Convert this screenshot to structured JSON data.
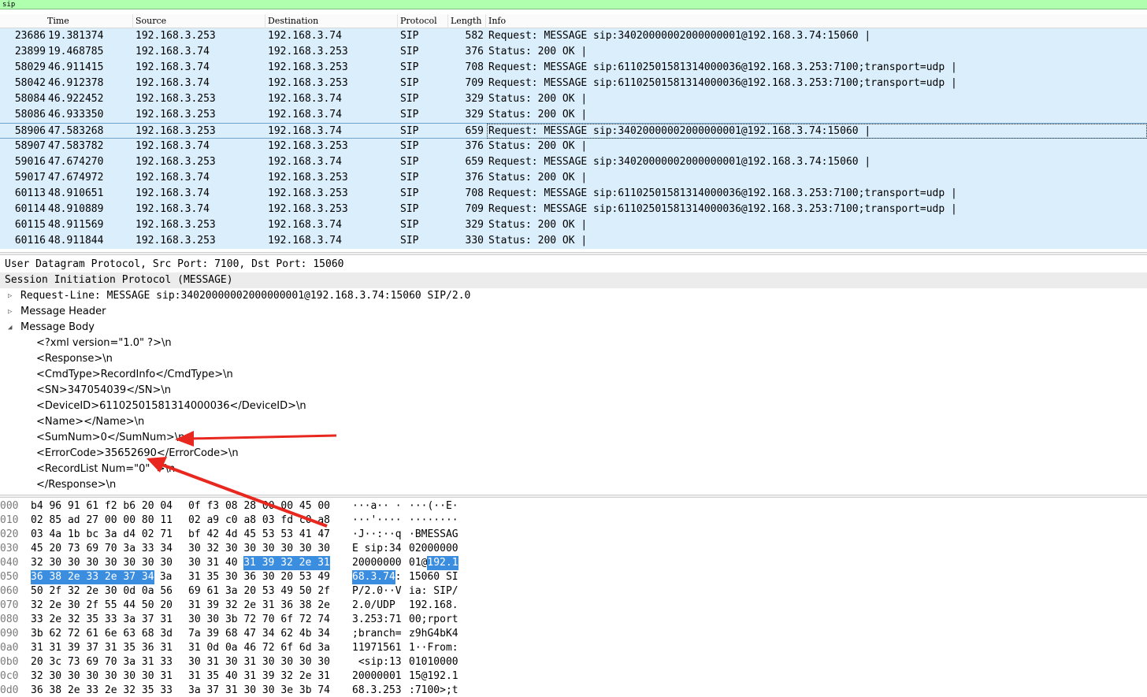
{
  "filter": {
    "value": "sip"
  },
  "columns": [
    "Time",
    "Source",
    "Destination",
    "Protocol",
    "Length",
    "Info"
  ],
  "packets": [
    {
      "no": "23686",
      "time": "19.381374",
      "src": "192.168.3.253",
      "dst": "192.168.3.74",
      "proto": "SIP",
      "len": "582",
      "info": "Request: MESSAGE sip:34020000002000000001@192.168.3.74:15060 |"
    },
    {
      "no": "23899",
      "time": "19.468785",
      "src": "192.168.3.74",
      "dst": "192.168.3.253",
      "proto": "SIP",
      "len": "376",
      "info": "Status: 200 OK |"
    },
    {
      "no": "58029",
      "time": "46.911415",
      "src": "192.168.3.74",
      "dst": "192.168.3.253",
      "proto": "SIP",
      "len": "708",
      "info": "Request: MESSAGE sip:61102501581314000036@192.168.3.253:7100;transport=udp |"
    },
    {
      "no": "58042",
      "time": "46.912378",
      "src": "192.168.3.74",
      "dst": "192.168.3.253",
      "proto": "SIP",
      "len": "709",
      "info": "Request: MESSAGE sip:61102501581314000036@192.168.3.253:7100;transport=udp |"
    },
    {
      "no": "58084",
      "time": "46.922452",
      "src": "192.168.3.253",
      "dst": "192.168.3.74",
      "proto": "SIP",
      "len": "329",
      "info": "Status: 200 OK |"
    },
    {
      "no": "58086",
      "time": "46.933350",
      "src": "192.168.3.253",
      "dst": "192.168.3.74",
      "proto": "SIP",
      "len": "329",
      "info": "Status: 200 OK |"
    },
    {
      "no": "58906",
      "time": "47.583268",
      "src": "192.168.3.253",
      "dst": "192.168.3.74",
      "proto": "SIP",
      "len": "659",
      "info": "Request: MESSAGE sip:34020000002000000001@192.168.3.74:15060 |"
    },
    {
      "no": "58907",
      "time": "47.583782",
      "src": "192.168.3.74",
      "dst": "192.168.3.253",
      "proto": "SIP",
      "len": "376",
      "info": "Status: 200 OK |"
    },
    {
      "no": "59016",
      "time": "47.674270",
      "src": "192.168.3.253",
      "dst": "192.168.3.74",
      "proto": "SIP",
      "len": "659",
      "info": "Request: MESSAGE sip:34020000002000000001@192.168.3.74:15060 |"
    },
    {
      "no": "59017",
      "time": "47.674972",
      "src": "192.168.3.74",
      "dst": "192.168.3.253",
      "proto": "SIP",
      "len": "376",
      "info": "Status: 200 OK |"
    },
    {
      "no": "60113",
      "time": "48.910651",
      "src": "192.168.3.74",
      "dst": "192.168.3.253",
      "proto": "SIP",
      "len": "708",
      "info": "Request: MESSAGE sip:61102501581314000036@192.168.3.253:7100;transport=udp |"
    },
    {
      "no": "60114",
      "time": "48.910889",
      "src": "192.168.3.74",
      "dst": "192.168.3.253",
      "proto": "SIP",
      "len": "709",
      "info": "Request: MESSAGE sip:61102501581314000036@192.168.3.253:7100;transport=udp |"
    },
    {
      "no": "60115",
      "time": "48.911569",
      "src": "192.168.3.253",
      "dst": "192.168.3.74",
      "proto": "SIP",
      "len": "329",
      "info": "Status: 200 OK |"
    },
    {
      "no": "60116",
      "time": "48.911844",
      "src": "192.168.3.253",
      "dst": "192.168.3.74",
      "proto": "SIP",
      "len": "330",
      "info": "Status: 200 OK |"
    }
  ],
  "details": {
    "udp": "User Datagram Protocol, Src Port: 7100, Dst Port: 15060",
    "sip": "Session Initiation Protocol (MESSAGE)",
    "request_line": "Request-Line: MESSAGE sip:34020000002000000001@192.168.3.74:15060 SIP/2.0",
    "message_header": "Message Header",
    "message_body": "Message Body",
    "xml_lines": [
      "<?xml version=\"1.0\" ?>\\n",
      "<Response>\\n",
      "<CmdType>RecordInfo</CmdType>\\n",
      "<SN>347054039</SN>\\n",
      "<DeviceID>61102501581314000036</DeviceID>\\n",
      "<Name></Name>\\n",
      "<SumNum>0</SumNum>\\n",
      "<ErrorCode>35652690</ErrorCode>\\n",
      "<RecordList Num=\"0\"  >\\n",
      "</Response>\\n"
    ]
  },
  "bytes": [
    {
      "off": "000",
      "hex1": "b4 96 91 61 f2 b6 20 04",
      "hex2": "0f f3 08 28 00 00 45 00",
      "asc1": "···a·· ·",
      "asc2": "···(··E·"
    },
    {
      "off": "010",
      "hex1": "02 85 ad 27 00 00 80 11",
      "hex2": "02 a9 c0 a8 03 fd c0 a8",
      "asc1": "···'····",
      "asc2": "········"
    },
    {
      "off": "020",
      "hex1": "03 4a 1b bc 3a d4 02 71",
      "hex2": "bf 42 4d 45 53 53 41 47",
      "asc1": "·J··:··q",
      "asc2": "·BMESSAG"
    },
    {
      "off": "030",
      "hex1": "45 20 73 69 70 3a 33 34",
      "hex2": "30 32 30 30 30 30 30 30",
      "asc1": "E sip:34",
      "asc2": "02000000"
    },
    {
      "off": "040",
      "hex1": "32 30 30 30 30 30 30 30",
      "hex2": "30 31 40 ",
      "hex2hl": "31 39 32 2e 31",
      "asc1": "20000000",
      "asc2": "01@",
      "asc2hl": "192.1"
    },
    {
      "off": "050",
      "hex1hl": "36 38 2e 33 2e 37 34",
      "hex1": " 3a",
      "hex2": "31 35 30 36 30 20 53 49",
      "asc1hl": "68.3.74",
      "asc1": ":",
      "asc2": "15060 SI"
    },
    {
      "off": "060",
      "hex1": "50 2f 32 2e 30 0d 0a 56",
      "hex2": "69 61 3a 20 53 49 50 2f",
      "asc1": "P/2.0··V",
      "asc2": "ia: SIP/"
    },
    {
      "off": "070",
      "hex1": "32 2e 30 2f 55 44 50 20",
      "hex2": "31 39 32 2e 31 36 38 2e",
      "asc1": "2.0/UDP ",
      "asc2": "192.168."
    },
    {
      "off": "080",
      "hex1": "33 2e 32 35 33 3a 37 31",
      "hex2": "30 30 3b 72 70 6f 72 74",
      "asc1": "3.253:71",
      "asc2": "00;rport"
    },
    {
      "off": "090",
      "hex1": "3b 62 72 61 6e 63 68 3d",
      "hex2": "7a 39 68 47 34 62 4b 34",
      "asc1": ";branch=",
      "asc2": "z9hG4bK4"
    },
    {
      "off": "0a0",
      "hex1": "31 31 39 37 31 35 36 31",
      "hex2": "31 0d 0a 46 72 6f 6d 3a",
      "asc1": "11971561",
      "asc2": "1··From:"
    },
    {
      "off": "0b0",
      "hex1": "20 3c 73 69 70 3a 31 33",
      "hex2": "30 31 30 31 30 30 30 30",
      "asc1": " <sip:13",
      "asc2": "01010000"
    },
    {
      "off": "0c0",
      "hex1": "32 30 30 30 30 30 30 31",
      "hex2": "31 35 40 31 39 32 2e 31",
      "asc1": "20000001",
      "asc2": "15@192.1"
    },
    {
      "off": "0d0",
      "hex1": "36 38 2e 33 2e 32 35 33",
      "hex2": "3a 37 31 30 30 3e 3b 74",
      "asc1": "68.3.253",
      "asc2": ":7100>;t"
    }
  ],
  "colors": {
    "row_bg": "#dbeefc",
    "filter_bg": "#afffaf",
    "highlight": "#3b8de0",
    "annotation": "#e8281e"
  },
  "icons": {
    "collapsed": "triangle-right-icon",
    "expanded": "triangle-down-icon"
  }
}
